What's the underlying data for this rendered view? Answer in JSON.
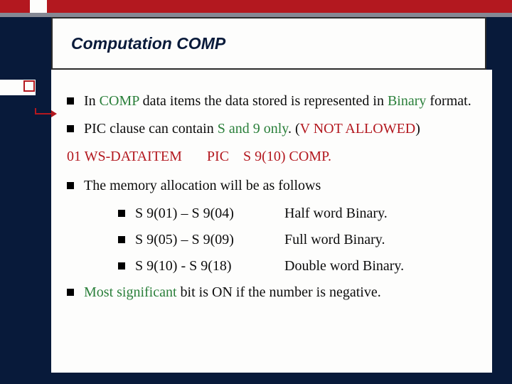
{
  "title": "Computation COMP",
  "bullets": {
    "b1_pre": "In ",
    "b1_kw": "COMP",
    "b1_mid": " data items  the  data stored is represented in ",
    "b1_kw2": "Binary",
    "b1_post": " format.",
    "b2_pre": "PIC clause can contain ",
    "b2_kw": "S and 9 only",
    "b2_post": ". (",
    "b2_red": "V NOT ALLOWED",
    "b2_close": ")",
    "b3": "The memory allocation will be as follows",
    "b4_kw": "Most significant",
    "b4_post": " bit is ON if the number is negative."
  },
  "codeline": {
    "level": "01",
    "name": "WS-DATAITEM",
    "pic_kw": "PIC",
    "pic_val": "S 9(10) COMP."
  },
  "table": {
    "r1c1": "S 9(01) – S 9(04)",
    "r1c2": "Half word Binary.",
    "r2c1": "S 9(05) – S 9(09)",
    "r2c2": "Full word Binary.",
    "r3c1": "S 9(10) - S 9(18)",
    "r3c2": "Double word Binary."
  }
}
